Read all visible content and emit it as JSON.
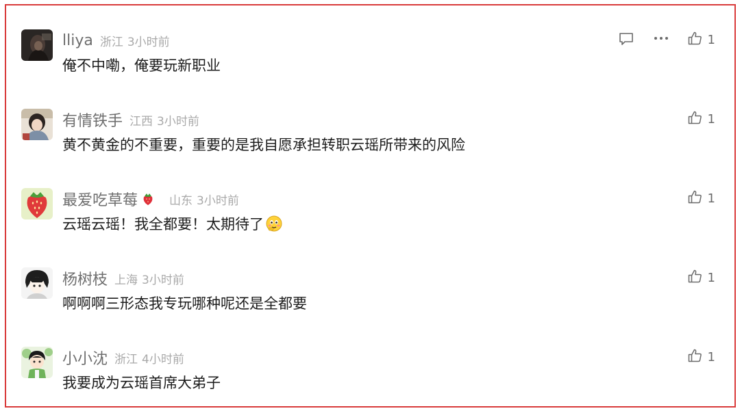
{
  "comments": [
    {
      "username": "lliya",
      "location": "浙江",
      "time": "3小时前",
      "text": "俺不中嘞，俺要玩新职业",
      "likes": "1",
      "avatar": "dark-portrait",
      "show_actions": true
    },
    {
      "username": "有情铁手",
      "location": "江西",
      "time": "3小时前",
      "text": "黄不黄金的不重要，重要的是我自愿承担转职云瑶所带来的风险",
      "likes": "1",
      "avatar": "girl-portrait"
    },
    {
      "username": "最爱吃草莓",
      "badge": "strawberry-icon",
      "location": "山东",
      "time": "3小时前",
      "text": "云瑶云瑶！我全都要！太期待了",
      "emoji": "shy-face-emoji",
      "likes": "1",
      "avatar": "strawberry"
    },
    {
      "username": "杨树枝",
      "location": "上海",
      "time": "3小时前",
      "text": "啊啊啊三形态我专玩哪种呢还是全都要",
      "likes": "1",
      "avatar": "anime-boy"
    },
    {
      "username": "小小沈",
      "location": "浙江",
      "time": "4小时前",
      "text": "我要成为云瑶首席大弟子",
      "likes": "1",
      "avatar": "cartoon-boy"
    }
  ],
  "colors": {
    "border": "#d93a3a",
    "username": "#6e6e6e",
    "meta": "#a9a9a9",
    "text": "#1c1c1c",
    "icon": "#6a6a6a"
  }
}
